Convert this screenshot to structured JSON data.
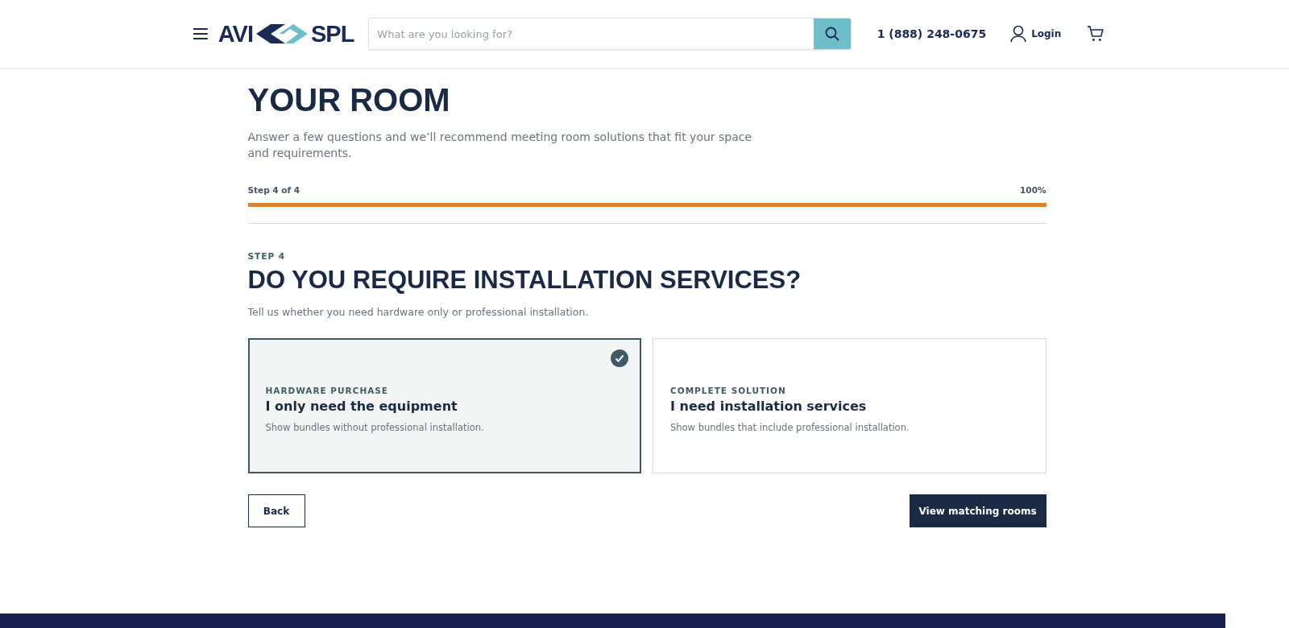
{
  "header": {
    "logo": {
      "left": "AVI",
      "right": "SPL"
    },
    "search": {
      "placeholder": "What are you looking for?"
    },
    "phone": "1 (888) 248-0675",
    "login": "Login"
  },
  "intro": {
    "title_lines": [
      "YOUR ROOM"
    ],
    "description": "Answer a few questions and we’ll recommend meeting room solutions that fit your space and requirements."
  },
  "progress": {
    "label": "Step 4 of 4",
    "reading": "100%",
    "level": 1
  },
  "step": {
    "eyebrow": "STEP 4",
    "title": "DO YOU REQUIRE INSTALLATION SERVICES?",
    "subtitle": "Tell us whether you need hardware only or professional installation.",
    "options": [
      {
        "eyebrow": "HARDWARE PURCHASE",
        "title": "I only need the equipment",
        "description": "Show bundles without professional installation.",
        "selected": true
      },
      {
        "eyebrow": "COMPLETE SOLUTION",
        "title": "I need installation services",
        "description": "Show bundles that include professional installation.",
        "selected": false
      }
    ]
  },
  "buttons": {
    "back": "Back",
    "next": "View matching rooms"
  }
}
